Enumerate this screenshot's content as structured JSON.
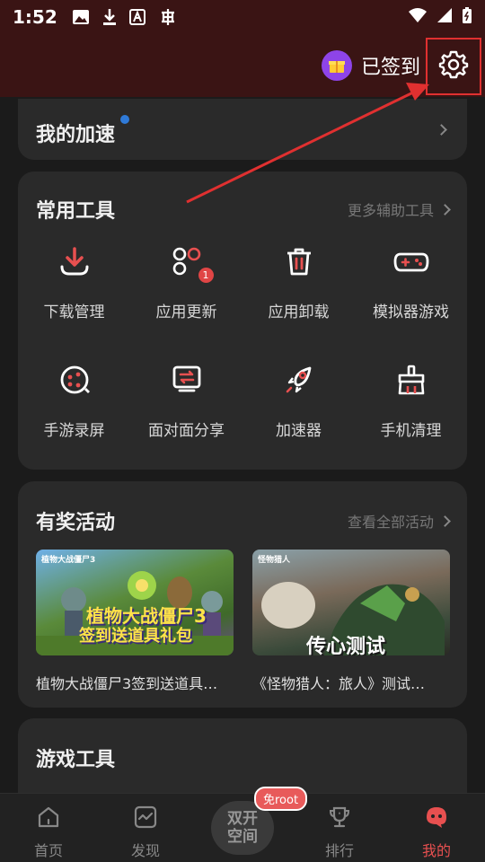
{
  "status_bar": {
    "time": "1:52"
  },
  "header": {
    "signin_label": "已签到"
  },
  "acceleration": {
    "title": "我的加速"
  },
  "tools": {
    "title": "常用工具",
    "more_label": "更多辅助工具",
    "items": [
      {
        "label": "下载管理",
        "icon": "download-icon"
      },
      {
        "label": "应用更新",
        "icon": "app-update-icon",
        "badge": "1"
      },
      {
        "label": "应用卸载",
        "icon": "trash-icon"
      },
      {
        "label": "模拟器游戏",
        "icon": "gamepad-icon"
      },
      {
        "label": "手游录屏",
        "icon": "record-icon"
      },
      {
        "label": "面对面分享",
        "icon": "share-icon"
      },
      {
        "label": "加速器",
        "icon": "rocket-icon"
      },
      {
        "label": "手机清理",
        "icon": "broom-icon"
      }
    ]
  },
  "activities": {
    "title": "有奖活动",
    "more_label": "查看全部活动",
    "items": [
      {
        "caption": "植物大战僵尸3签到送道具…",
        "banner_text_1": "植物大战僵尸3",
        "banner_text_2": "签到送道具礼包",
        "logo_text": "植物大战僵尸3"
      },
      {
        "caption": "《怪物猎人：旅人》测试…",
        "banner_text": "传心测试",
        "logo_text": "怪物猎人"
      }
    ]
  },
  "game_tools": {
    "title": "游戏工具"
  },
  "tabbar": {
    "home": "首页",
    "discover": "发现",
    "center_line1": "双开",
    "center_line2": "空间",
    "root_badge": "免root",
    "rank": "排行",
    "mine": "我的"
  },
  "colors": {
    "accent": "#e85050",
    "header_bg": "#3a1414",
    "card_bg": "#2a2a2a",
    "annotation": "#e03030"
  }
}
